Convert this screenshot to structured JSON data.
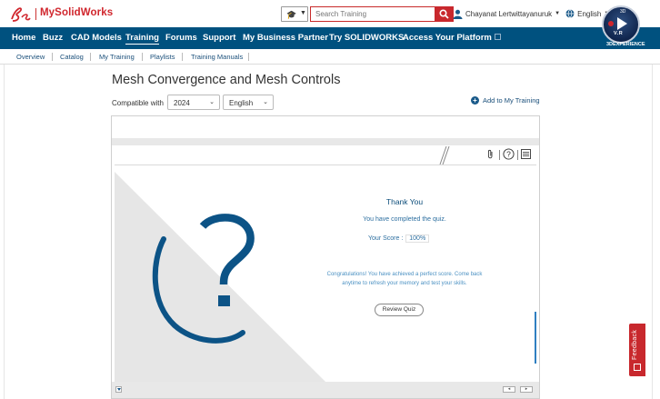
{
  "brand": {
    "name": "MySolidWorks"
  },
  "search": {
    "category_icon": "graduation-cap-icon",
    "placeholder": "Search Training"
  },
  "user": {
    "name": "Chayanat Lertwittayanuruk",
    "language": "English"
  },
  "compass": {
    "label": "V.R",
    "brand": "3DEXPERIENCE"
  },
  "nav": {
    "items": [
      {
        "label": "Home"
      },
      {
        "label": "Buzz"
      },
      {
        "label": "CAD Models"
      },
      {
        "label": "Training"
      },
      {
        "label": "Forums"
      },
      {
        "label": "Support"
      },
      {
        "label": "My Business Partner"
      },
      {
        "label": "Try SOLIDWORKS"
      },
      {
        "label": "Access Your Platform"
      }
    ],
    "active": "Training"
  },
  "subnav": {
    "items": [
      {
        "label": "Overview"
      },
      {
        "label": "Catalog"
      },
      {
        "label": "My Training"
      },
      {
        "label": "Playlists"
      },
      {
        "label": "Training Manuals"
      }
    ]
  },
  "page": {
    "title": "Mesh Convergence and Mesh Controls",
    "compat_label": "Compatible with",
    "version": "2024",
    "language": "English",
    "add_training": "Add to My Training"
  },
  "quiz": {
    "title": "Thank You",
    "completed": "You have completed the quiz.",
    "score_label": "Your Score :",
    "score_value": "100%",
    "congrats_line1": "Congratulations! You have achieved a perfect score. Come back",
    "congrats_line2": "anytime to refresh your memory and test your skills.",
    "review_button": "Review Quiz"
  },
  "feedback": {
    "label": "Feedback"
  },
  "colors": {
    "brand_red": "#d0262d",
    "nav_blue": "#00517f",
    "quiz_blue": "#0c4d7a"
  }
}
